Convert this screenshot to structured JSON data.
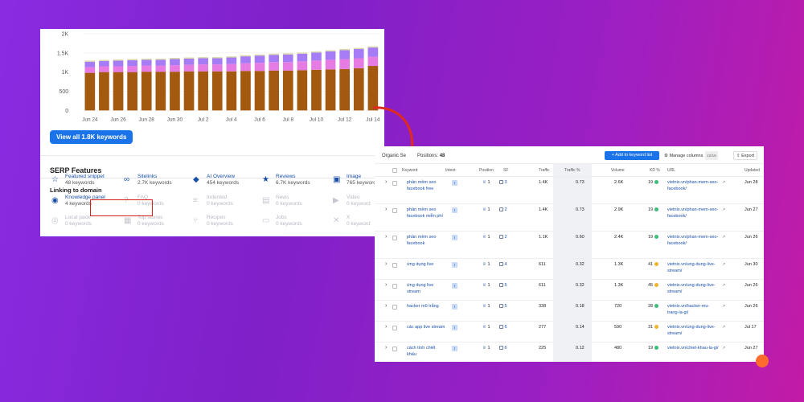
{
  "chart_data": {
    "type": "bar",
    "categories": [
      "Jun 24",
      "Jun 25",
      "Jun 26",
      "Jun 27",
      "Jun 28",
      "Jun 29",
      "Jun 30",
      "Jul 1",
      "Jul 2",
      "Jul 3",
      "Jul 4",
      "Jul 5",
      "Jul 6",
      "Jul 7",
      "Jul 8",
      "Jul 9",
      "Jul 10",
      "Jul 11",
      "Jul 12",
      "Jul 13",
      "Jul 14"
    ],
    "x_tick_labels": [
      "Jun 24",
      "Jun 26",
      "Jun 28",
      "Jun 30",
      "Jul 2",
      "Jul 4",
      "Jul 6",
      "Jul 8",
      "Jul 10",
      "Jul 12",
      "Jul 14"
    ],
    "y_tick_labels": [
      "0",
      "500",
      "1K",
      "1.5K",
      "2K"
    ],
    "ylim": [
      0,
      2000
    ],
    "series": [
      {
        "values": [
          980,
          1000,
          1000,
          1000,
          1010,
          1010,
          1010,
          1020,
          1020,
          1020,
          1020,
          1030,
          1030,
          1040,
          1040,
          1050,
          1060,
          1070,
          1080,
          1100,
          1160
        ]
      },
      {
        "values": [
          150,
          150,
          150,
          160,
          160,
          160,
          170,
          170,
          180,
          180,
          190,
          200,
          210,
          220,
          220,
          230,
          240,
          250,
          260,
          260,
          240
        ]
      },
      {
        "values": [
          140,
          140,
          150,
          150,
          150,
          150,
          160,
          160,
          160,
          160,
          170,
          180,
          190,
          190,
          200,
          200,
          210,
          220,
          230,
          240,
          240
        ]
      },
      {
        "values": [
          30,
          30,
          30,
          30,
          30,
          30,
          30,
          30,
          30,
          30,
          30,
          30,
          30,
          30,
          30,
          30,
          30,
          30,
          30,
          30,
          30
        ]
      }
    ],
    "colors": [
      "#a35a0f",
      "#e67ce3",
      "#a57cf5",
      "#d9d9a8"
    ]
  },
  "left": {
    "view_all": "View all 1.8K keywords",
    "serp_title": "SERP Features",
    "linking_title": "Linking to domain",
    "features": [
      {
        "name": "Featured snippet",
        "count": "48 keywords",
        "icon": "featured-snippet-icon",
        "active": true
      },
      {
        "name": "Sitelinks",
        "count": "2.7K keywords",
        "icon": "sitelinks-icon",
        "active": true
      },
      {
        "name": "AI Overview",
        "count": "454 keywords",
        "icon": "ai-overview-icon",
        "active": true
      },
      {
        "name": "Reviews",
        "count": "6.7K keywords",
        "icon": "reviews-star-icon",
        "active": true
      },
      {
        "name": "Image",
        "count": "765 keyword",
        "icon": "image-icon",
        "active": true
      },
      {
        "name": "Knowledge panel",
        "count": "4 keywords",
        "icon": "knowledge-panel-icon",
        "active": true
      },
      {
        "name": "FAQ",
        "count": "0 keywords",
        "icon": "faq-icon",
        "active": false
      },
      {
        "name": "Indented",
        "count": "0 keywords",
        "icon": "indented-icon",
        "active": false
      },
      {
        "name": "News",
        "count": "0 keywords",
        "icon": "news-icon",
        "active": false
      },
      {
        "name": "Video",
        "count": "0 keyword",
        "icon": "video-icon",
        "active": false
      },
      {
        "name": "Local pack",
        "count": "0 keywords",
        "icon": "local-pack-icon",
        "active": false
      },
      {
        "name": "Top stories",
        "count": "0 keywords",
        "icon": "top-stories-icon",
        "active": false
      },
      {
        "name": "Recipes",
        "count": "0 keywords",
        "icon": "recipes-icon",
        "active": false
      },
      {
        "name": "Jobs",
        "count": "0 keywords",
        "icon": "jobs-icon",
        "active": false
      },
      {
        "name": "X",
        "count": "0 keyword",
        "icon": "x-icon",
        "active": false
      }
    ]
  },
  "right": {
    "label_prefix": "Organic Se",
    "label_suffix": "Positions:",
    "positions_count": "48",
    "add_btn": "+ Add to keyword list",
    "manage_btn": "Manage columns",
    "manage_count": "10/16",
    "export_btn": "Export",
    "headers": {
      "keyword": "Keyword",
      "intent": "Intent",
      "position": "Position",
      "sf": "SF",
      "traffic": "Traffic",
      "traffic_pct": "Traffic %",
      "volume": "Volume",
      "kd": "KD %",
      "url": "URL",
      "updated": "Updated"
    },
    "rows": [
      {
        "kw": "phần mềm seo facebook free",
        "intent": "I",
        "pos": "1",
        "sf": "3",
        "traffic": "1.4K",
        "tpct": "0.73",
        "volume": "2.6K",
        "kd": "19",
        "kd_color": "#3bbf7a",
        "url": "vietnix.vn/phan-mem-seo-facebook/",
        "updated": "Jun 28"
      },
      {
        "kw": "phần mềm seo facebook miễn phí",
        "intent": "I",
        "pos": "1",
        "sf": "2",
        "traffic": "1.4K",
        "tpct": "0.73",
        "volume": "2.9K",
        "kd": "19",
        "kd_color": "#3bbf7a",
        "url": "vietnix.vn/phan-mem-seo-facebook/",
        "updated": "Jun 27"
      },
      {
        "kw": "phần mềm seo facebook",
        "intent": "I",
        "pos": "1",
        "sf": "2",
        "traffic": "1.1K",
        "tpct": "0.60",
        "volume": "2.4K",
        "kd": "19",
        "kd_color": "#3bbf7a",
        "url": "vietnix.vn/phan-mem-seo-facebook/",
        "updated": "Jun 26"
      },
      {
        "kw": "ứng dụng live",
        "intent": "I",
        "pos": "1",
        "sf": "4",
        "traffic": "611",
        "tpct": "0.32",
        "volume": "1.3K",
        "kd": "41",
        "kd_color": "#f0b429",
        "url": "vietnix.vn/ung-dung-live-stream/",
        "updated": "Jun 30"
      },
      {
        "kw": "ứng dụng live stream",
        "intent": "I",
        "pos": "1",
        "sf": "5",
        "traffic": "611",
        "tpct": "0.32",
        "volume": "1.3K",
        "kd": "45",
        "kd_color": "#f0b429",
        "url": "vietnix.vn/ung-dung-live-stream/",
        "updated": "Jun 26"
      },
      {
        "kw": "hacker mũ trắng",
        "intent": "I",
        "pos": "1",
        "sf": "5",
        "traffic": "338",
        "tpct": "0.18",
        "volume": "720",
        "kd": "28",
        "kd_color": "#3bbf7a",
        "url": "vietnix.vn/hacker-mu-trang-la-gi/",
        "updated": "Jun 26"
      },
      {
        "kw": "các app live stream",
        "intent": "I",
        "pos": "1",
        "sf": "6",
        "traffic": "277",
        "tpct": "0.14",
        "volume": "590",
        "kd": "31",
        "kd_color": "#f0b429",
        "url": "vietnix.vn/ung-dung-live-stream/",
        "updated": "Jul 17"
      },
      {
        "kw": "cách tính chiết khấu",
        "intent": "I",
        "pos": "1",
        "sf": "6",
        "traffic": "225",
        "tpct": "0.12",
        "volume": "480",
        "kd": "19",
        "kd_color": "#3bbf7a",
        "url": "vietnix.vn/chiet-khau-la-gi/",
        "updated": "Jun 27"
      }
    ]
  }
}
